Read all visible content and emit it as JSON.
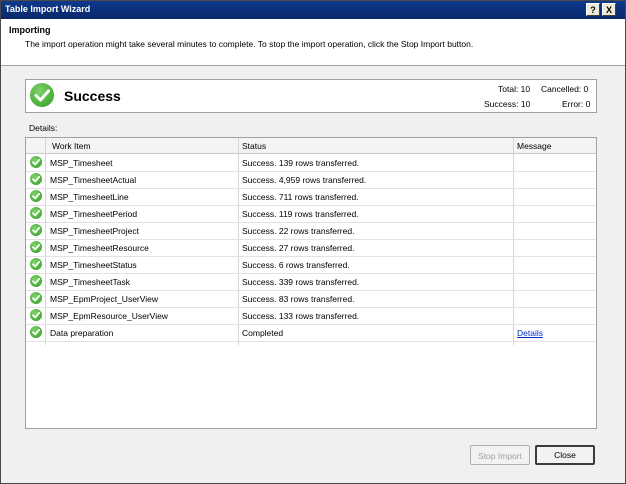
{
  "window": {
    "title": "Table Import Wizard"
  },
  "titlebar": {
    "help_label": "?",
    "close_label": "X"
  },
  "header": {
    "title": "Importing",
    "description": "The import operation might take several minutes to complete. To stop the import operation, click the Stop Import button."
  },
  "status": {
    "label": "Success",
    "total": "Total: 10",
    "cancelled": "Cancelled: 0",
    "success": "Success: 10",
    "error": "Error: 0"
  },
  "details_label": "Details:",
  "columns": {
    "work_item": "Work Item",
    "status": "Status",
    "message": "Message"
  },
  "rows": [
    {
      "work_item": "MSP_Timesheet",
      "status": "Success. 139 rows transferred.",
      "message": ""
    },
    {
      "work_item": "MSP_TimesheetActual",
      "status": "Success. 4,959 rows transferred.",
      "message": ""
    },
    {
      "work_item": "MSP_TimesheetLine",
      "status": "Success. 711 rows transferred.",
      "message": ""
    },
    {
      "work_item": "MSP_TimesheetPeriod",
      "status": "Success. 119 rows transferred.",
      "message": ""
    },
    {
      "work_item": "MSP_TimesheetProject",
      "status": "Success. 22 rows transferred.",
      "message": ""
    },
    {
      "work_item": "MSP_TimesheetResource",
      "status": "Success. 27 rows transferred.",
      "message": ""
    },
    {
      "work_item": "MSP_TimesheetStatus",
      "status": "Success. 6 rows transferred.",
      "message": ""
    },
    {
      "work_item": "MSP_TimesheetTask",
      "status": "Success. 339 rows transferred.",
      "message": ""
    },
    {
      "work_item": "MSP_EpmProject_UserView",
      "status": "Success. 83 rows transferred.",
      "message": ""
    },
    {
      "work_item": "MSP_EpmResource_UserView",
      "status": "Success. 133 rows transferred.",
      "message": ""
    },
    {
      "work_item": "Data preparation",
      "status": "Completed",
      "message": "Details"
    }
  ],
  "buttons": {
    "stop_import": "Stop Import",
    "close": "Close"
  },
  "icons": {
    "row_status": "success-check-icon",
    "summary": "success-check-icon"
  },
  "colors": {
    "titlebar": "#0a2a6b",
    "success_green": "#2f9a22",
    "link": "#0033cc"
  }
}
